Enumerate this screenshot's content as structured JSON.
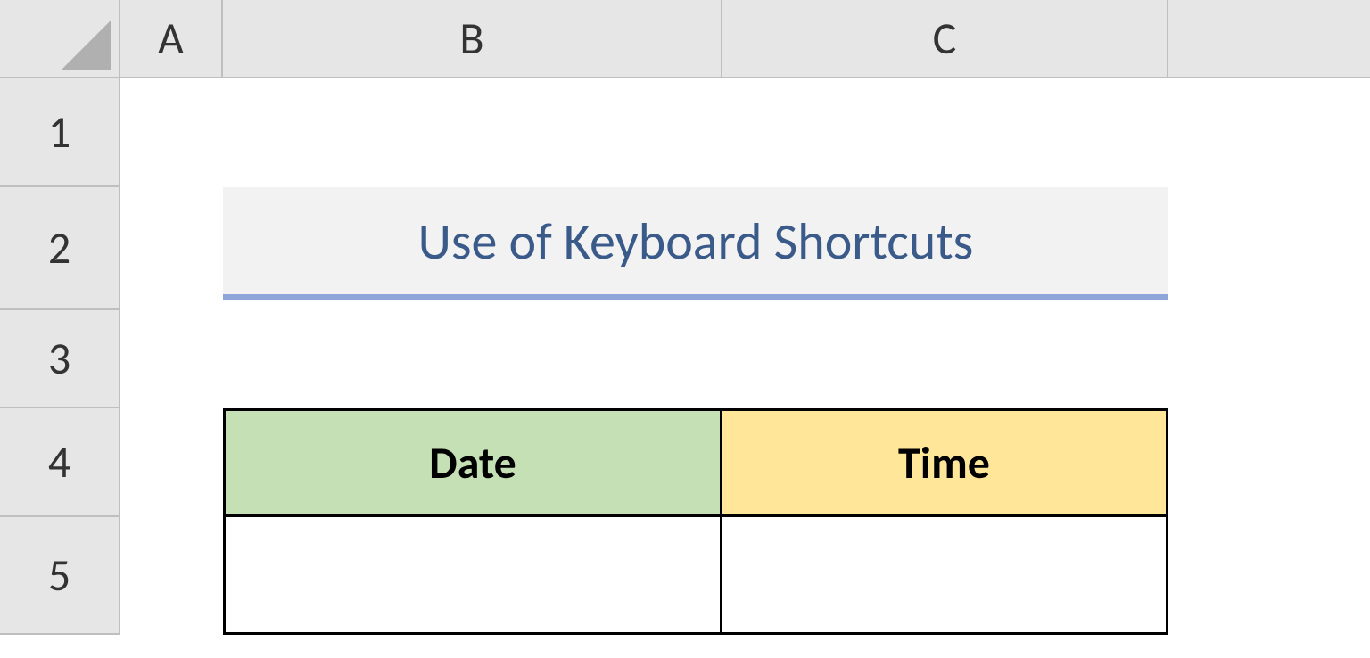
{
  "columns": {
    "A": "A",
    "B": "B",
    "C": "C"
  },
  "rows": {
    "r1": "1",
    "r2": "2",
    "r3": "3",
    "r4": "4",
    "r5": "5"
  },
  "cells": {
    "B2C2_title": "Use of Keyboard Shortcuts",
    "B4_header": "Date",
    "C4_header": "Time",
    "B5_value": "",
    "C5_value": ""
  },
  "colors": {
    "title_text": "#3a5a8a",
    "title_underline": "#8ea5d9",
    "header_date_bg": "#c5e0b4",
    "header_time_bg": "#ffe699"
  }
}
